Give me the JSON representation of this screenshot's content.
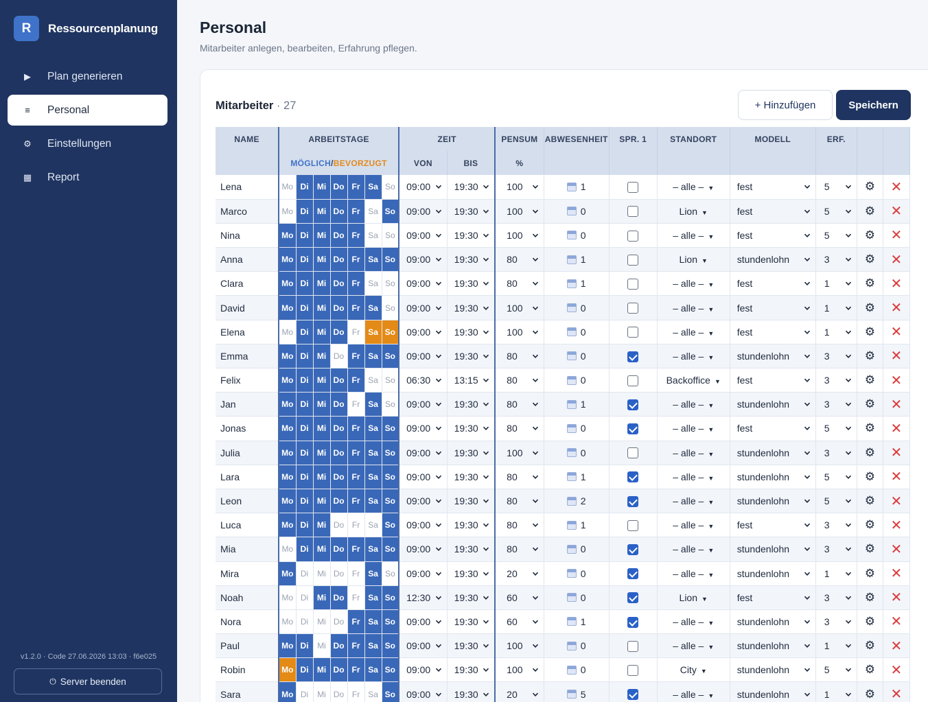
{
  "app": {
    "logo_letter": "R",
    "title": "Ressourcenplanung"
  },
  "nav": [
    {
      "label": "Plan generieren",
      "icon": "play-icon",
      "glyph": "▶",
      "active": false
    },
    {
      "label": "Personal",
      "icon": "list-icon",
      "glyph": "≡",
      "active": true
    },
    {
      "label": "Einstellungen",
      "icon": "gear-icon",
      "glyph": "⚙",
      "active": false
    },
    {
      "label": "Report",
      "icon": "grid-icon",
      "glyph": "▦",
      "active": false
    }
  ],
  "footer": {
    "version": "v1.2.0 · Code 27.06.2026 13:03 · f6e025",
    "server_button": "Server beenden"
  },
  "page": {
    "title": "Personal",
    "subtitle": "Mitarbeiter anlegen, bearbeiten, Erfahrung pflegen."
  },
  "card": {
    "title": "Mitarbeiter",
    "count": "· 27",
    "add_button": "+ Hinzufügen",
    "save_button": "Speichern"
  },
  "table": {
    "headers": {
      "name": "NAME",
      "workdays": "ARBEITSTAGE",
      "time": "ZEIT",
      "pensum": "PENSUM",
      "absence": "ABWESENHEIT",
      "spr": "SPR. 1",
      "location": "STANDORT",
      "model": "MODELL",
      "erf": "ERF."
    },
    "subheaders": {
      "possible": "MÖGLICH",
      "sep": "/",
      "preferred": "BEVORZUGT",
      "from": "VON",
      "to": "BIS",
      "percent": "%"
    },
    "day_labels": [
      "Mo",
      "Di",
      "Mi",
      "Do",
      "Fr",
      "Sa",
      "So"
    ],
    "colors": {
      "day_on": "#3a68b8",
      "day_preferred": "#e38a17",
      "delete": "#d93a3a",
      "sidebar": "#1f3460"
    },
    "rows": [
      {
        "name": "Lena",
        "days": [
          0,
          1,
          1,
          1,
          1,
          1,
          0
        ],
        "from": "09:00",
        "to": "19:30",
        "pensum": "100",
        "absence": "1",
        "spr": false,
        "location": "– alle –",
        "model": "fest",
        "erf": "5"
      },
      {
        "name": "Marco",
        "days": [
          0,
          1,
          1,
          1,
          1,
          0,
          1
        ],
        "from": "09:00",
        "to": "19:30",
        "pensum": "100",
        "absence": "0",
        "spr": false,
        "location": "Lion",
        "model": "fest",
        "erf": "5"
      },
      {
        "name": "Nina",
        "days": [
          1,
          1,
          1,
          1,
          1,
          0,
          0
        ],
        "from": "09:00",
        "to": "19:30",
        "pensum": "100",
        "absence": "0",
        "spr": false,
        "location": "– alle –",
        "model": "fest",
        "erf": "5"
      },
      {
        "name": "Anna",
        "days": [
          1,
          1,
          1,
          1,
          1,
          1,
          1
        ],
        "from": "09:00",
        "to": "19:30",
        "pensum": "80",
        "absence": "1",
        "spr": false,
        "location": "Lion",
        "model": "stundenlohn",
        "erf": "3"
      },
      {
        "name": "Clara",
        "days": [
          1,
          1,
          1,
          1,
          1,
          0,
          0
        ],
        "from": "09:00",
        "to": "19:30",
        "pensum": "80",
        "absence": "1",
        "spr": false,
        "location": "– alle –",
        "model": "fest",
        "erf": "1"
      },
      {
        "name": "David",
        "days": [
          1,
          1,
          1,
          1,
          1,
          1,
          0
        ],
        "from": "09:00",
        "to": "19:30",
        "pensum": "100",
        "absence": "0",
        "spr": false,
        "location": "– alle –",
        "model": "fest",
        "erf": "1"
      },
      {
        "name": "Elena",
        "days": [
          0,
          1,
          1,
          1,
          0,
          2,
          2
        ],
        "from": "09:00",
        "to": "19:30",
        "pensum": "100",
        "absence": "0",
        "spr": false,
        "location": "– alle –",
        "model": "fest",
        "erf": "1"
      },
      {
        "name": "Emma",
        "days": [
          1,
          1,
          1,
          0,
          1,
          1,
          1
        ],
        "from": "09:00",
        "to": "19:30",
        "pensum": "80",
        "absence": "0",
        "spr": true,
        "location": "– alle –",
        "model": "stundenlohn",
        "erf": "3"
      },
      {
        "name": "Felix",
        "days": [
          1,
          1,
          1,
          1,
          1,
          0,
          0
        ],
        "from": "06:30",
        "to": "13:15",
        "pensum": "80",
        "absence": "0",
        "spr": false,
        "location": "Backoffice",
        "model": "fest",
        "erf": "3"
      },
      {
        "name": "Jan",
        "days": [
          1,
          1,
          1,
          1,
          0,
          1,
          0
        ],
        "from": "09:00",
        "to": "19:30",
        "pensum": "80",
        "absence": "1",
        "spr": true,
        "location": "– alle –",
        "model": "stundenlohn",
        "erf": "3"
      },
      {
        "name": "Jonas",
        "days": [
          1,
          1,
          1,
          1,
          1,
          1,
          1
        ],
        "from": "09:00",
        "to": "19:30",
        "pensum": "80",
        "absence": "0",
        "spr": true,
        "location": "– alle –",
        "model": "fest",
        "erf": "5"
      },
      {
        "name": "Julia",
        "days": [
          1,
          1,
          1,
          1,
          1,
          1,
          1
        ],
        "from": "09:00",
        "to": "19:30",
        "pensum": "100",
        "absence": "0",
        "spr": false,
        "location": "– alle –",
        "model": "stundenlohn",
        "erf": "3"
      },
      {
        "name": "Lara",
        "days": [
          1,
          1,
          1,
          1,
          1,
          1,
          1
        ],
        "from": "09:00",
        "to": "19:30",
        "pensum": "80",
        "absence": "1",
        "spr": true,
        "location": "– alle –",
        "model": "stundenlohn",
        "erf": "5"
      },
      {
        "name": "Leon",
        "days": [
          1,
          1,
          1,
          1,
          1,
          1,
          1
        ],
        "from": "09:00",
        "to": "19:30",
        "pensum": "80",
        "absence": "2",
        "spr": true,
        "location": "– alle –",
        "model": "stundenlohn",
        "erf": "5"
      },
      {
        "name": "Luca",
        "days": [
          1,
          1,
          1,
          0,
          0,
          0,
          1
        ],
        "from": "09:00",
        "to": "19:30",
        "pensum": "80",
        "absence": "1",
        "spr": false,
        "location": "– alle –",
        "model": "fest",
        "erf": "3"
      },
      {
        "name": "Mia",
        "days": [
          0,
          1,
          1,
          1,
          1,
          1,
          1
        ],
        "from": "09:00",
        "to": "19:30",
        "pensum": "80",
        "absence": "0",
        "spr": true,
        "location": "– alle –",
        "model": "stundenlohn",
        "erf": "3"
      },
      {
        "name": "Mira",
        "days": [
          1,
          0,
          0,
          0,
          0,
          1,
          0
        ],
        "from": "09:00",
        "to": "19:30",
        "pensum": "20",
        "absence": "0",
        "spr": true,
        "location": "– alle –",
        "model": "stundenlohn",
        "erf": "1"
      },
      {
        "name": "Noah",
        "days": [
          0,
          0,
          1,
          1,
          0,
          1,
          1
        ],
        "from": "12:30",
        "to": "19:30",
        "pensum": "60",
        "absence": "0",
        "spr": true,
        "location": "Lion",
        "model": "fest",
        "erf": "3"
      },
      {
        "name": "Nora",
        "days": [
          0,
          0,
          0,
          0,
          1,
          1,
          1
        ],
        "from": "09:00",
        "to": "19:30",
        "pensum": "60",
        "absence": "1",
        "spr": true,
        "location": "– alle –",
        "model": "stundenlohn",
        "erf": "3"
      },
      {
        "name": "Paul",
        "days": [
          1,
          1,
          0,
          1,
          1,
          1,
          1
        ],
        "from": "09:00",
        "to": "19:30",
        "pensum": "100",
        "absence": "0",
        "spr": false,
        "location": "– alle –",
        "model": "stundenlohn",
        "erf": "1"
      },
      {
        "name": "Robin",
        "days": [
          2,
          1,
          1,
          1,
          1,
          1,
          1
        ],
        "from": "09:00",
        "to": "19:30",
        "pensum": "100",
        "absence": "0",
        "spr": false,
        "location": "City",
        "model": "stundenlohn",
        "erf": "5"
      },
      {
        "name": "Sara",
        "days": [
          1,
          0,
          0,
          0,
          0,
          0,
          1
        ],
        "from": "09:00",
        "to": "19:30",
        "pensum": "20",
        "absence": "5",
        "spr": true,
        "location": "– alle –",
        "model": "stundenlohn",
        "erf": "1"
      }
    ]
  }
}
